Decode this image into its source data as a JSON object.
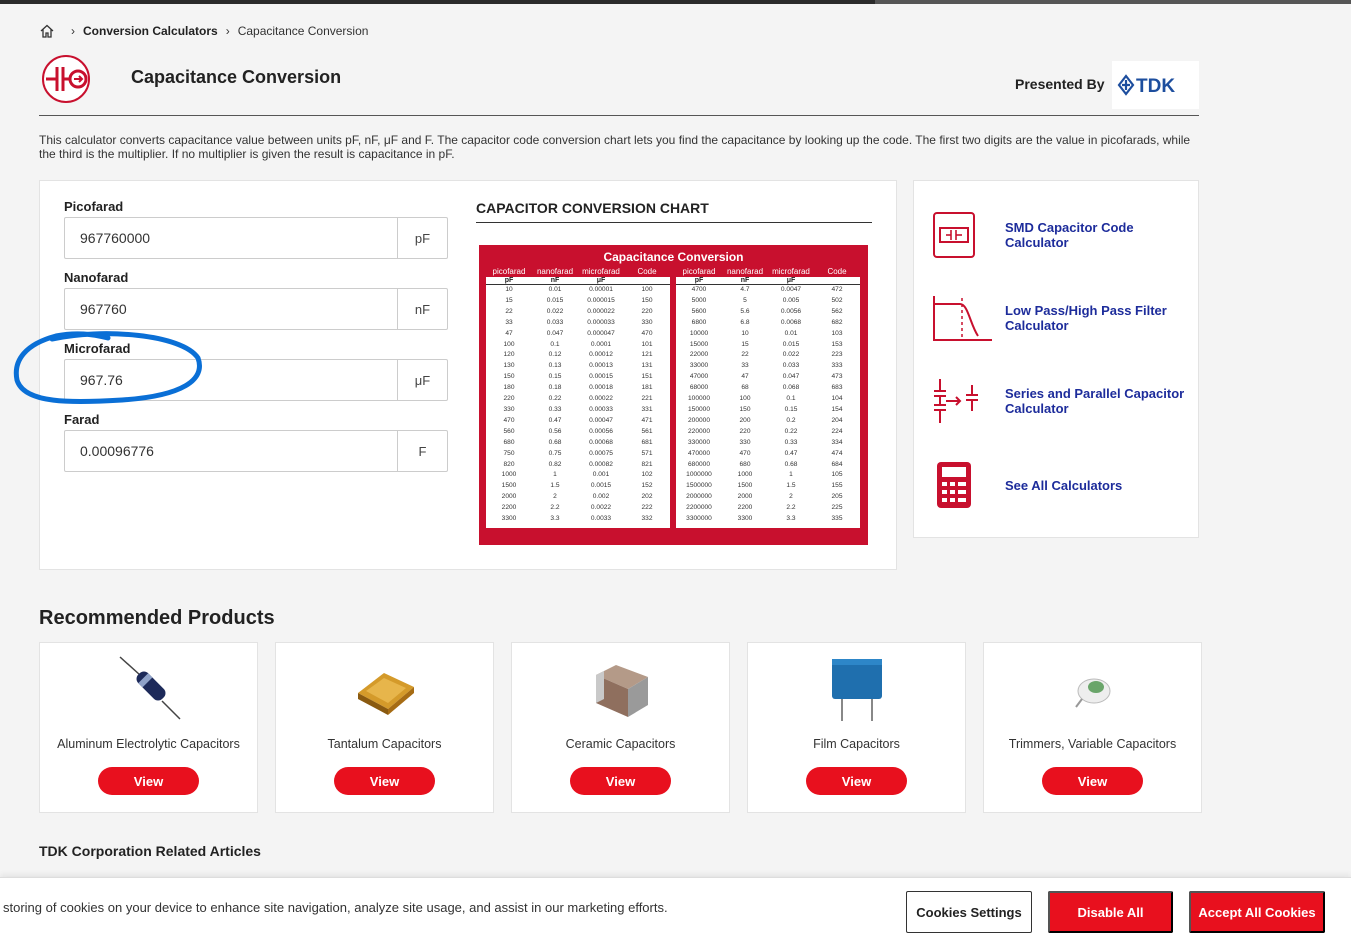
{
  "breadcrumb": {
    "level1": "Conversion Calculators",
    "level2": "Capacitance Conversion"
  },
  "header": {
    "title": "Capacitance Conversion",
    "presented_by": "Presented By",
    "brand": "TDK",
    "brand_color": "#1d4e9e"
  },
  "intro": "This calculator converts capacitance value between units pF, nF, μF and F. The capacitor code conversion chart lets you find the capacitance by looking up the code. The first two digits are the value in picofarads, while the third is the multiplier. If no multiplier is given the result is capacitance in pF.",
  "fields": [
    {
      "label": "Picofarad",
      "value": "967760000",
      "unit": "pF"
    },
    {
      "label": "Nanofarad",
      "value": "967760",
      "unit": "nF"
    },
    {
      "label": "Microfarad",
      "value": "967.76",
      "unit": "μF"
    },
    {
      "label": "Farad",
      "value": "0.00096776",
      "unit": "F"
    }
  ],
  "chart": {
    "section_title": "CAPACITOR CONVERSION CHART",
    "image_title": "Capacitance Conversion",
    "col_headers": [
      "picofarad",
      "nanofarad",
      "microfarad",
      "Code"
    ],
    "col_units": [
      "pF",
      "nF",
      "μF",
      ""
    ],
    "left_rows": [
      [
        "10",
        "0.01",
        "0.00001",
        "100"
      ],
      [
        "15",
        "0.015",
        "0.000015",
        "150"
      ],
      [
        "22",
        "0.022",
        "0.000022",
        "220"
      ],
      [
        "33",
        "0.033",
        "0.000033",
        "330"
      ],
      [
        "47",
        "0.047",
        "0.000047",
        "470"
      ],
      [
        "100",
        "0.1",
        "0.0001",
        "101"
      ],
      [
        "120",
        "0.12",
        "0.00012",
        "121"
      ],
      [
        "130",
        "0.13",
        "0.00013",
        "131"
      ],
      [
        "150",
        "0.15",
        "0.00015",
        "151"
      ],
      [
        "180",
        "0.18",
        "0.00018",
        "181"
      ],
      [
        "220",
        "0.22",
        "0.00022",
        "221"
      ],
      [
        "330",
        "0.33",
        "0.00033",
        "331"
      ],
      [
        "470",
        "0.47",
        "0.00047",
        "471"
      ],
      [
        "560",
        "0.56",
        "0.00056",
        "561"
      ],
      [
        "680",
        "0.68",
        "0.00068",
        "681"
      ],
      [
        "750",
        "0.75",
        "0.00075",
        "571"
      ],
      [
        "820",
        "0.82",
        "0.00082",
        "821"
      ],
      [
        "1000",
        "1",
        "0.001",
        "102"
      ],
      [
        "1500",
        "1.5",
        "0.0015",
        "152"
      ],
      [
        "2000",
        "2",
        "0.002",
        "202"
      ],
      [
        "2200",
        "2.2",
        "0.0022",
        "222"
      ],
      [
        "3300",
        "3.3",
        "0.0033",
        "332"
      ]
    ],
    "right_rows": [
      [
        "4700",
        "4.7",
        "0.0047",
        "472"
      ],
      [
        "5000",
        "5",
        "0.005",
        "502"
      ],
      [
        "5600",
        "5.6",
        "0.0056",
        "562"
      ],
      [
        "6800",
        "6.8",
        "0.0068",
        "682"
      ],
      [
        "10000",
        "10",
        "0.01",
        "103"
      ],
      [
        "15000",
        "15",
        "0.015",
        "153"
      ],
      [
        "22000",
        "22",
        "0.022",
        "223"
      ],
      [
        "33000",
        "33",
        "0.033",
        "333"
      ],
      [
        "47000",
        "47",
        "0.047",
        "473"
      ],
      [
        "68000",
        "68",
        "0.068",
        "683"
      ],
      [
        "100000",
        "100",
        "0.1",
        "104"
      ],
      [
        "150000",
        "150",
        "0.15",
        "154"
      ],
      [
        "200000",
        "200",
        "0.2",
        "204"
      ],
      [
        "220000",
        "220",
        "0.22",
        "224"
      ],
      [
        "330000",
        "330",
        "0.33",
        "334"
      ],
      [
        "470000",
        "470",
        "0.47",
        "474"
      ],
      [
        "680000",
        "680",
        "0.68",
        "684"
      ],
      [
        "1000000",
        "1000",
        "1",
        "105"
      ],
      [
        "1500000",
        "1500",
        "1.5",
        "155"
      ],
      [
        "2000000",
        "2000",
        "2",
        "205"
      ],
      [
        "2200000",
        "2200",
        "2.2",
        "225"
      ],
      [
        "3300000",
        "3300",
        "3.3",
        "335"
      ]
    ]
  },
  "related_calculators": [
    {
      "label": "SMD Capacitor Code Calculator",
      "icon": "smd-capacitor-icon"
    },
    {
      "label": "Low Pass/High Pass Filter Calculator",
      "icon": "filter-graph-icon"
    },
    {
      "label": "Series and Parallel Capacitor Calculator",
      "icon": "series-parallel-icon"
    },
    {
      "label": "See All Calculators",
      "icon": "calculator-icon"
    }
  ],
  "recommended": {
    "title": "Recommended Products",
    "button_label": "View",
    "items": [
      {
        "name": "Aluminum Electrolytic Capacitors",
        "icon": "electrolytic-capacitor-image"
      },
      {
        "name": "Tantalum Capacitors",
        "icon": "tantalum-capacitor-image"
      },
      {
        "name": "Ceramic Capacitors",
        "icon": "ceramic-capacitor-image"
      },
      {
        "name": "Film Capacitors",
        "icon": "film-capacitor-image"
      },
      {
        "name": "Trimmers, Variable Capacitors",
        "icon": "trimmer-capacitor-image"
      }
    ]
  },
  "articles_title": "TDK Corporation Related Articles",
  "cookie": {
    "message": "storing of cookies on your device to enhance site navigation, analyze site usage, and assist in our marketing efforts.",
    "settings": "Cookies Settings",
    "disable": "Disable All",
    "accept": "Accept All Cookies"
  },
  "colors": {
    "accent_red": "#e8101e",
    "link_blue": "#1d2c9b",
    "annotation_blue": "#0a6fd6"
  }
}
